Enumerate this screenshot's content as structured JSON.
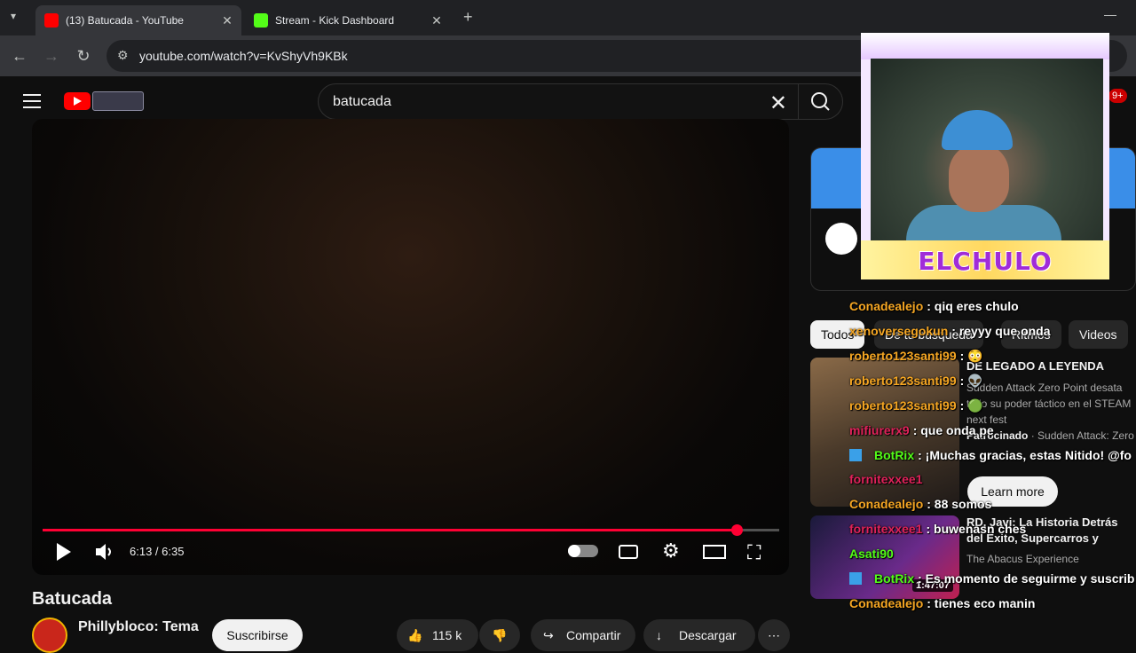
{
  "browser": {
    "tabs": [
      {
        "title": "(13) Batucada - YouTube",
        "active": true
      },
      {
        "title": "Stream - Kick Dashboard",
        "active": false
      }
    ],
    "url": "youtube.com/watch?v=KvShyVh9KBk"
  },
  "youtube": {
    "search_query": "batucada",
    "notification_count": "9+",
    "player": {
      "time": "6:13 / 6:35",
      "progress": 0.942
    },
    "video": {
      "title": "Batucada",
      "channel": "Phillybloco: Tema",
      "subscribe": "Suscribirse",
      "likes": "115 k",
      "share": "Compartir",
      "download": "Descargar"
    },
    "chips": [
      "Todos",
      "De tu búsqueda",
      "Ritmos",
      "Videos"
    ],
    "ad": {
      "title": "DE LEGADO A LEYENDA",
      "description": "Sudden Attack Zero Point desata todo su poder táctico en el STEAM next fest",
      "sponsor_label": "Patrocinado",
      "sponsor": "Sudden Attack: Zero ...",
      "cta": "Learn more"
    },
    "related": {
      "title": "RD, Javi: La Historia Detrás del Éxito, Supercarros y Familia ...",
      "channel": "The Abacus Experience",
      "duration": "1:47:07"
    }
  },
  "stream_overlay": {
    "streamer_name": "ELCHULO",
    "chat": [
      {
        "user": "Conadealejo",
        "message": ": qiq eres chulo",
        "color": "#f5a623"
      },
      {
        "user": "xenoversegokun",
        "message": ": reyyy que onda",
        "color": "#f5a623"
      },
      {
        "user": "roberto123santi99",
        "message": ": 😳",
        "color": "#f5a623"
      },
      {
        "user": "roberto123santi99",
        "message": ": 👽",
        "color": "#f5a623"
      },
      {
        "user": "roberto123santi99",
        "message": ": 🟢",
        "color": "#f5a623"
      },
      {
        "user": "mifiurerx9",
        "message": ": que onda pe",
        "color": "#e0225a"
      },
      {
        "user": "BotRix",
        "message": ": ¡Muchas gracias, estas Nitido! @fo",
        "color": "#53fc18"
      },
      {
        "user": "fornitexxee1",
        "message": "",
        "color": "#e0225a"
      },
      {
        "user": "Conadealejo",
        "message": ": 88 somos",
        "color": "#f5a623"
      },
      {
        "user": "fornitexxee1",
        "message": ": buwenasn ches",
        "color": "#e0225a"
      },
      {
        "user": "Asati90",
        "message": "",
        "color": "#53fc18"
      },
      {
        "user": "BotRix",
        "message": ": Es momento de seguirme y suscrib",
        "color": "#53fc18"
      },
      {
        "user": "Conadealejo",
        "message": ": tienes eco manin",
        "color": "#f5a623"
      }
    ]
  }
}
